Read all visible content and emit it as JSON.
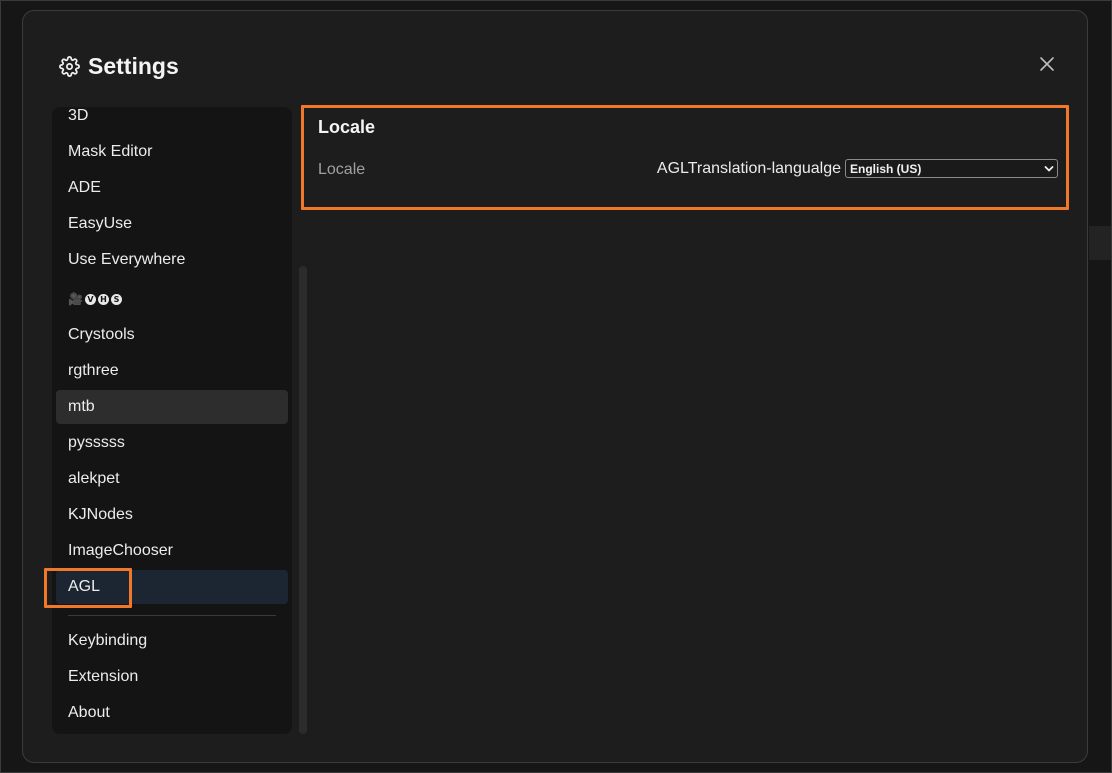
{
  "dialog": {
    "title": "Settings",
    "close_icon": "close-icon",
    "title_icon": "gear-icon"
  },
  "sidebar": {
    "items": [
      {
        "label": "3D"
      },
      {
        "label": "Mask Editor"
      },
      {
        "label": "ADE"
      },
      {
        "label": "EasyUse"
      },
      {
        "label": "Use Everywhere"
      },
      {
        "label": "🎥ⓋⒽⓈ",
        "glyphs": [
          "🎥",
          "V",
          "H",
          "S"
        ]
      },
      {
        "label": "Crystools"
      },
      {
        "label": "rgthree"
      },
      {
        "label": "mtb"
      },
      {
        "label": "pysssss"
      },
      {
        "label": "alekpet"
      },
      {
        "label": "KJNodes"
      },
      {
        "label": "ImageChooser"
      },
      {
        "label": "AGL"
      }
    ],
    "footer_items": [
      {
        "label": "Keybinding"
      },
      {
        "label": "Extension"
      },
      {
        "label": "About"
      }
    ]
  },
  "panel": {
    "heading": "Locale",
    "setting": {
      "label": "Locale",
      "control_label": "AGLTranslation-langualge",
      "selected_value": "English (US)"
    }
  },
  "colors": {
    "highlight": "#f0782a",
    "active_item_gray": "#2d2d2d",
    "active_item_blue": "#1c2532",
    "dialog_bg": "#1d1d1d"
  }
}
